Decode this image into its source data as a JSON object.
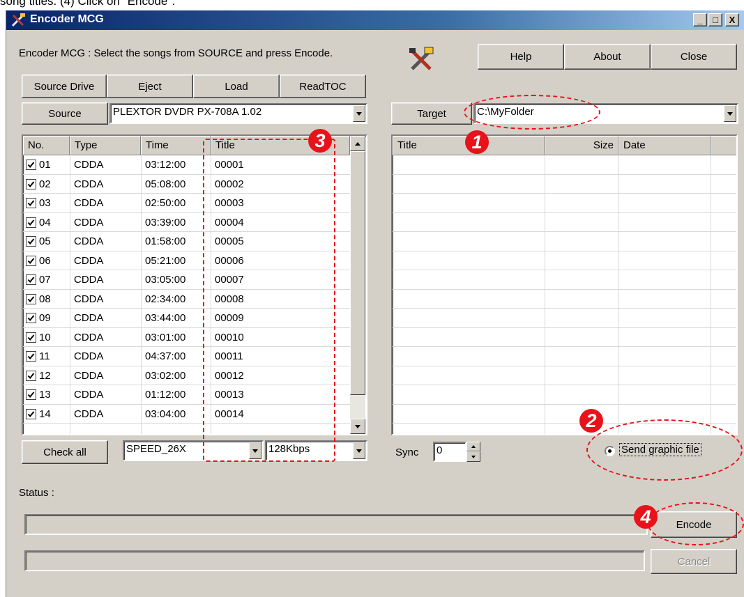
{
  "caption": "song titles.  (4) Click on \"Encode\".",
  "window": {
    "title": "Encoder MCG",
    "minimize": "_",
    "maximize": "□",
    "close": "X"
  },
  "instructions": "Encoder MCG : Select the songs from SOURCE and press Encode.",
  "top_buttons": {
    "help": "Help",
    "about": "About",
    "close": "Close"
  },
  "source_buttons": {
    "drive": "Source Drive",
    "eject": "Eject",
    "load": "Load",
    "readtoc": "ReadTOC"
  },
  "source": {
    "label": "Source",
    "value": "PLEXTOR DVDR   PX-708A 1.02"
  },
  "target": {
    "label": "Target",
    "value": "C:\\MyFolder"
  },
  "source_table": {
    "columns": [
      "No.",
      "Type",
      "Time",
      "Title"
    ],
    "rows": [
      {
        "no": "01",
        "type": "CDDA",
        "time": "03:12:00",
        "title": "00001",
        "checked": true
      },
      {
        "no": "02",
        "type": "CDDA",
        "time": "05:08:00",
        "title": "00002",
        "checked": true
      },
      {
        "no": "03",
        "type": "CDDA",
        "time": "02:50:00",
        "title": "00003",
        "checked": true
      },
      {
        "no": "04",
        "type": "CDDA",
        "time": "03:39:00",
        "title": "00004",
        "checked": true
      },
      {
        "no": "05",
        "type": "CDDA",
        "time": "01:58:00",
        "title": "00005",
        "checked": true
      },
      {
        "no": "06",
        "type": "CDDA",
        "time": "05:21:00",
        "title": "00006",
        "checked": true
      },
      {
        "no": "07",
        "type": "CDDA",
        "time": "03:05:00",
        "title": "00007",
        "checked": true
      },
      {
        "no": "08",
        "type": "CDDA",
        "time": "02:34:00",
        "title": "00008",
        "checked": true
      },
      {
        "no": "09",
        "type": "CDDA",
        "time": "03:44:00",
        "title": "00009",
        "checked": true
      },
      {
        "no": "10",
        "type": "CDDA",
        "time": "03:01:00",
        "title": "00010",
        "checked": true
      },
      {
        "no": "11",
        "type": "CDDA",
        "time": "04:37:00",
        "title": "00011",
        "checked": true
      },
      {
        "no": "12",
        "type": "CDDA",
        "time": "03:02:00",
        "title": "00012",
        "checked": true
      },
      {
        "no": "13",
        "type": "CDDA",
        "time": "01:12:00",
        "title": "00013",
        "checked": true
      },
      {
        "no": "14",
        "type": "CDDA",
        "time": "03:04:00",
        "title": "00014",
        "checked": true
      }
    ]
  },
  "target_table": {
    "columns": [
      "Title",
      "Size",
      "Date"
    ]
  },
  "check_all": "Check all",
  "speed": "SPEED_26X",
  "bitrate": "128Kbps",
  "sync": {
    "label": "Sync",
    "value": "0"
  },
  "send_graphic": {
    "label": "Send graphic file",
    "selected": true
  },
  "status_label": "Status :",
  "encode": "Encode",
  "cancel": "Cancel",
  "annotations": [
    "1",
    "2",
    "3",
    "4"
  ],
  "colors": {
    "annotation": "#e8131a",
    "titlebar": "#0a246a",
    "face": "#d4d0c8"
  }
}
